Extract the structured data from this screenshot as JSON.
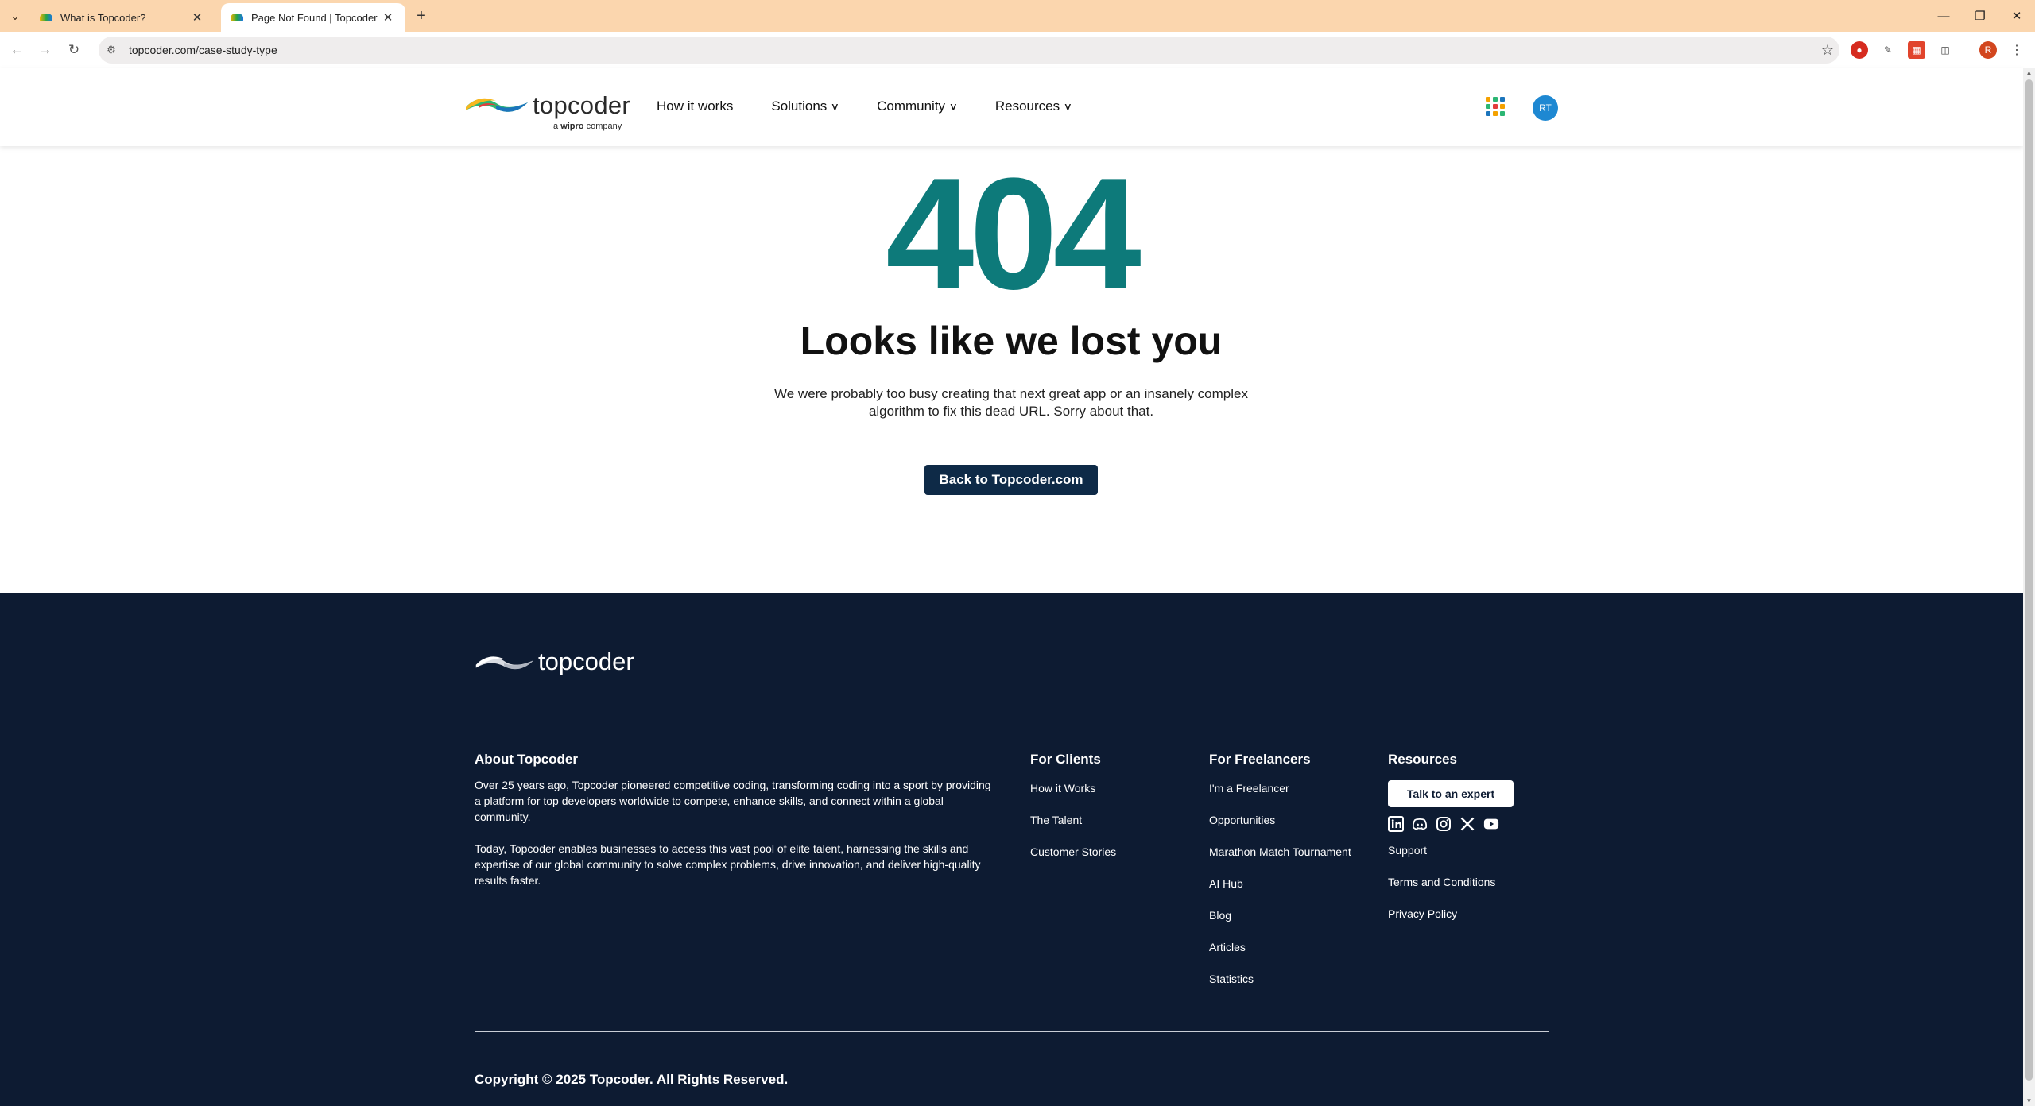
{
  "browser": {
    "tabs": [
      {
        "title": "What is Topcoder?",
        "active": false
      },
      {
        "title": "Page Not Found | Topcoder",
        "active": true
      }
    ],
    "url": "topcoder.com/case-study-type",
    "profile_initial": "R"
  },
  "header": {
    "logo_word": "topcoder",
    "logo_sub_prefix": "a",
    "logo_sub_brand": "wipro",
    "logo_sub_suffix": "company",
    "nav": [
      {
        "label": "How it works",
        "dropdown": false
      },
      {
        "label": "Solutions",
        "dropdown": true
      },
      {
        "label": "Community",
        "dropdown": true
      },
      {
        "label": "Resources",
        "dropdown": true
      }
    ],
    "avatar_initials": "RT"
  },
  "error": {
    "code": "404",
    "heading": "Looks like we lost you",
    "description_line1": "We were probably too busy creating that next great app or an insanely complex",
    "description_line2": "algorithm to fix this dead URL. Sorry about that.",
    "button_label": "Back to Topcoder.com"
  },
  "footer": {
    "logo_word": "topcoder",
    "about": {
      "heading": "About Topcoder",
      "paragraph1": "Over 25 years ago, Topcoder pioneered competitive coding, transforming coding into a sport by providing a platform for top developers worldwide to compete, enhance skills, and connect within a global community.",
      "paragraph2": "Today, Topcoder enables businesses to access this vast pool of elite talent, harnessing the skills and expertise of our global community to solve complex problems, drive innovation, and deliver high-quality results faster."
    },
    "clients": {
      "heading": "For Clients",
      "links": [
        "How it Works",
        "The Talent",
        "Customer Stories"
      ]
    },
    "freelancers": {
      "heading": "For Freelancers",
      "links": [
        "I'm a Freelancer",
        "Opportunities",
        "Marathon Match Tournament",
        "AI Hub",
        "Blog",
        "Articles",
        "Statistics"
      ]
    },
    "resources": {
      "heading": "Resources",
      "button_label": "Talk to an expert",
      "social_icons": [
        "linkedin-icon",
        "discord-icon",
        "instagram-icon",
        "x-icon",
        "youtube-icon"
      ],
      "links": [
        "Support",
        "Terms and Conditions",
        "Privacy Policy"
      ]
    },
    "copyright": "Copyright © 2025 Topcoder. All Rights Reserved."
  },
  "colors": {
    "tabbar": "#fbd6ae",
    "accent_teal": "#0d7a7a",
    "button_navy": "#0e2a47",
    "footer_bg": "#0d1b32",
    "avatar_blue": "#1e88d2"
  }
}
